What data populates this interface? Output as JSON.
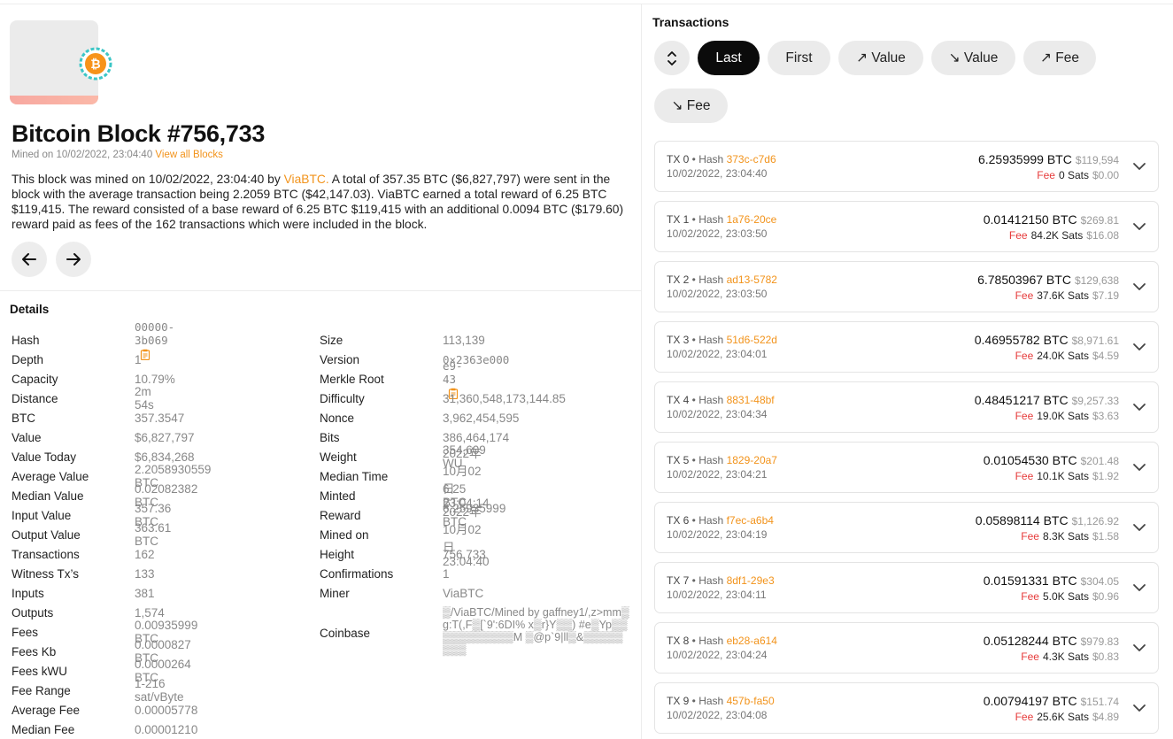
{
  "block": {
    "title": "Bitcoin Block #756,733",
    "mined_on_prefix": "Mined on 10/02/2022, 23:04:40",
    "view_all": "View all Blocks",
    "desc_pre": "This block was mined on 10/02/2022, 23:04:40 by ",
    "desc_miner": "ViaBTC.",
    "desc_post": " A total of 357.35 BTC ($6,827,797) were sent in the block with the average transaction being 2.2059 BTC ($42,147.03). ViaBTC earned a total reward of 6.25 BTC $119,415. The reward consisted of a base reward of 6.25 BTC $119,415 with an additional 0.0094 BTC ($179.60) reward paid as fees of the 162 transactions which were included in the block."
  },
  "details": {
    "title": "Details",
    "left": [
      {
        "label": "Hash",
        "value": "00000-3b069",
        "mono": true,
        "copy": true
      },
      {
        "label": "Depth",
        "value": "1"
      },
      {
        "label": "Capacity",
        "value": "10.79%"
      },
      {
        "label": "Distance",
        "value": "2m 54s"
      },
      {
        "label": "BTC",
        "value": "357.3547"
      },
      {
        "label": "Value",
        "value": "$6,827,797"
      },
      {
        "label": "Value Today",
        "value": "$6,834,268"
      },
      {
        "label": "Average Value",
        "value": "2.2058930559 BTC"
      },
      {
        "label": "Median Value",
        "value": "0.02082382 BTC"
      },
      {
        "label": "Input Value",
        "value": "357.36 BTC"
      },
      {
        "label": "Output Value",
        "value": "363.61 BTC"
      },
      {
        "label": "Transactions",
        "value": "162"
      },
      {
        "label": "Witness Tx’s",
        "value": "133"
      },
      {
        "label": "Inputs",
        "value": "381"
      },
      {
        "label": "Outputs",
        "value": "1,574"
      },
      {
        "label": "Fees",
        "value": "0.00935999 BTC"
      },
      {
        "label": "Fees Kb",
        "value": "0.0000827 BTC"
      },
      {
        "label": "Fees kWU",
        "value": "0.0000264 BTC"
      },
      {
        "label": "Fee Range",
        "value": "1-216 sat/vByte"
      },
      {
        "label": "Average Fee",
        "value": "0.00005778"
      },
      {
        "label": "Median Fee",
        "value": "0.00001210"
      }
    ],
    "right": [
      {
        "label": "Size",
        "value": "113,139"
      },
      {
        "label": "Version",
        "value": "0×2363e000",
        "mono": true
      },
      {
        "label": "Merkle Root",
        "value": "e9-43",
        "mono": true,
        "copy": true
      },
      {
        "label": "Difficulty",
        "value": "31,360,548,173,144.85"
      },
      {
        "label": "Nonce",
        "value": "3,962,454,595"
      },
      {
        "label": "Bits",
        "value": "386,464,174"
      },
      {
        "label": "Weight",
        "value": "354,609 WU"
      },
      {
        "label": "Median Time",
        "value": "2022年10月02日 23:04:14"
      },
      {
        "label": "Minted",
        "value": "6.25 BTC"
      },
      {
        "label": "Reward",
        "value": "6.25935999 BTC"
      },
      {
        "label": "Mined on",
        "value": "2022年10月02日 23:04:40"
      },
      {
        "label": "Height",
        "value": "756,733"
      },
      {
        "label": "Confirmations",
        "value": "1"
      },
      {
        "label": "Miner",
        "value": "ViaBTC"
      }
    ],
    "coinbase_label": "Coinbase",
    "coinbase_value": "▒/ViaBTC/Mined by gaffney1/,z>mm▒g:T(,F▒[`9':6DI% x▒r}Y▒▒) #e▒Yp▒▒▒▒▒▒▒▒▒▒▒M ▒@p`9|ll▒&▒▒▒▒▒▒▒▒"
  },
  "transactions": {
    "title": "Transactions",
    "filters": [
      "Last",
      "First",
      "↗ Value",
      "↘ Value",
      "↗ Fee",
      "↘ Fee"
    ],
    "active_filter": "Last",
    "items": [
      {
        "tx": "TX 0",
        "hash": "373c-c7d6",
        "time": "10/02/2022, 23:04:40",
        "btc": "6.25935999 BTC",
        "usd": "$119,594",
        "fee_sats": "0 Sats",
        "fee_usd": "$0.00"
      },
      {
        "tx": "TX 1",
        "hash": "1a76-20ce",
        "time": "10/02/2022, 23:03:50",
        "btc": "0.01412150 BTC",
        "usd": "$269.81",
        "fee_sats": "84.2K Sats",
        "fee_usd": "$16.08"
      },
      {
        "tx": "TX 2",
        "hash": "ad13-5782",
        "time": "10/02/2022, 23:03:50",
        "btc": "6.78503967 BTC",
        "usd": "$129,638",
        "fee_sats": "37.6K Sats",
        "fee_usd": "$7.19"
      },
      {
        "tx": "TX 3",
        "hash": "51d6-522d",
        "time": "10/02/2022, 23:04:01",
        "btc": "0.46955782 BTC",
        "usd": "$8,971.61",
        "fee_sats": "24.0K Sats",
        "fee_usd": "$4.59"
      },
      {
        "tx": "TX 4",
        "hash": "8831-48bf",
        "time": "10/02/2022, 23:04:34",
        "btc": "0.48451217 BTC",
        "usd": "$9,257.33",
        "fee_sats": "19.0K Sats",
        "fee_usd": "$3.63"
      },
      {
        "tx": "TX 5",
        "hash": "1829-20a7",
        "time": "10/02/2022, 23:04:21",
        "btc": "0.01054530 BTC",
        "usd": "$201.48",
        "fee_sats": "10.1K Sats",
        "fee_usd": "$1.92"
      },
      {
        "tx": "TX 6",
        "hash": "f7ec-a6b4",
        "time": "10/02/2022, 23:04:19",
        "btc": "0.05898114 BTC",
        "usd": "$1,126.92",
        "fee_sats": "8.3K Sats",
        "fee_usd": "$1.58"
      },
      {
        "tx": "TX 7",
        "hash": "8df1-29e3",
        "time": "10/02/2022, 23:04:11",
        "btc": "0.01591331 BTC",
        "usd": "$304.05",
        "fee_sats": "5.0K Sats",
        "fee_usd": "$0.96"
      },
      {
        "tx": "TX 8",
        "hash": "eb28-a614",
        "time": "10/02/2022, 23:04:24",
        "btc": "0.05128244 BTC",
        "usd": "$979.83",
        "fee_sats": "4.3K Sats",
        "fee_usd": "$0.83"
      },
      {
        "tx": "TX 9",
        "hash": "457b-fa50",
        "time": "10/02/2022, 23:04:08",
        "btc": "0.00794197 BTC",
        "usd": "$151.74",
        "fee_sats": "25.6K Sats",
        "fee_usd": "$4.89"
      }
    ],
    "fee_label": "Fee",
    "hash_label": "Hash"
  },
  "colors": {
    "accent": "#f2931b",
    "fee": "#e63b3b",
    "active_pill": "#0b0b0b",
    "pill": "#ebebeb"
  }
}
